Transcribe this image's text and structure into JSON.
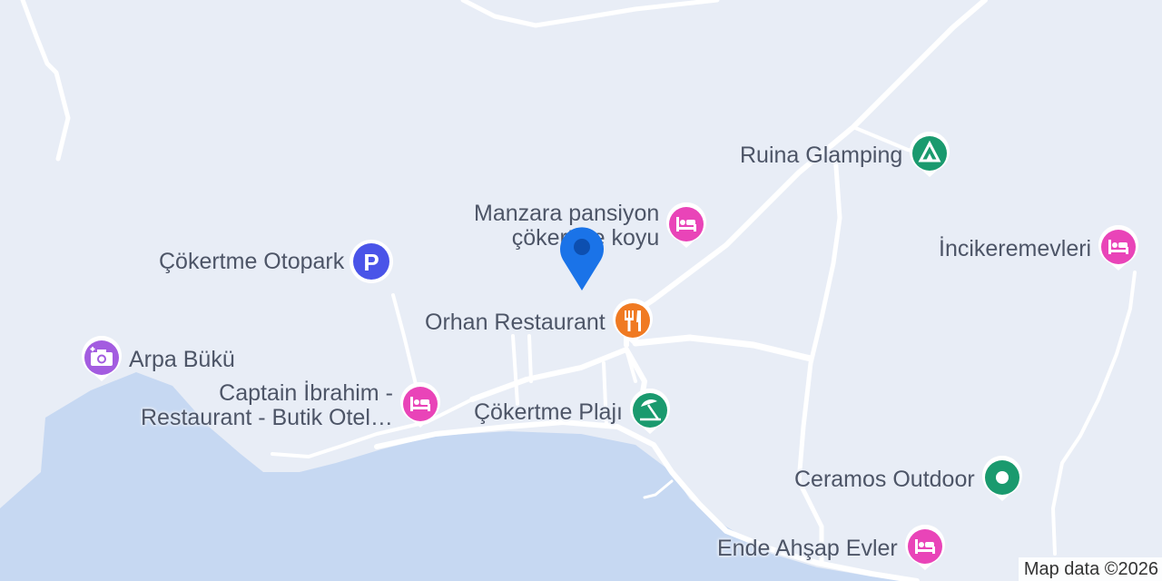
{
  "places": {
    "ruina": "Ruina Glamping",
    "manzara_line1": "Manzara pansiyon",
    "manzara_line2": "çökertme koyu",
    "incikeremevleri": "İncikeremevleri",
    "otopark": "Çökertme Otopark",
    "orhan": "Orhan Restaurant",
    "arpa": "Arpa Bükü",
    "captain_line1": "Captain İbrahim -",
    "captain_line2": "Restaurant - Butik Otel…",
    "plaji": "Çökertme Plajı",
    "ceramos": "Ceramos Outdoor",
    "ende": "Ende Ahşap Evler"
  },
  "icons": {
    "hotel": "bed-icon",
    "camping": "tent-icon",
    "parking": "parking-icon",
    "restaurant": "fork-knife-icon",
    "attraction": "camera-icon",
    "beach": "beach-umbrella-icon",
    "outdoor": "dot-icon",
    "location": "location-marker-icon"
  },
  "colors": {
    "land": "#e8edf6",
    "water": "#c6d8f2",
    "road": "#ffffff",
    "hotel": "#e944b8",
    "camping": "#1a9a6e",
    "parking": "#4a54e8",
    "restaurant": "#f07a22",
    "attraction": "#a35ce0",
    "beach": "#1a9a6e",
    "outdoor": "#1a9a6e",
    "location": "#1a73e8"
  },
  "attribution": "Map data ©2026"
}
